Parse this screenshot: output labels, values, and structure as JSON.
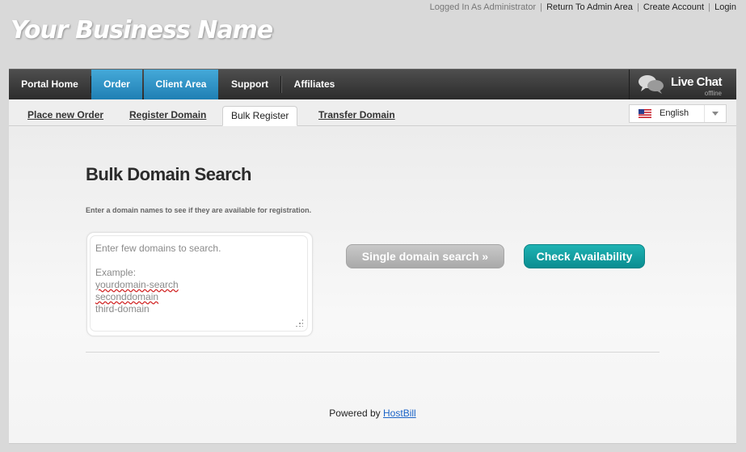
{
  "top_links": {
    "logged_in": "Logged In As Administrator",
    "separator": "|",
    "admin_area": "Return To Admin Area",
    "create_account": "Create Account",
    "login": "Login"
  },
  "brand": {
    "name": "Your Business Name"
  },
  "nav": {
    "items": [
      {
        "label": "Portal Home",
        "active": false
      },
      {
        "label": "Order",
        "active": true
      },
      {
        "label": "Client Area",
        "active": true
      },
      {
        "label": "Support",
        "active": false
      },
      {
        "label": "Affiliates",
        "active": false
      }
    ],
    "live_chat": {
      "title": "Live Chat",
      "status": "offline",
      "icon": "chat-bubbles-icon"
    }
  },
  "subtabs": [
    {
      "label": "Place new Order",
      "active": false
    },
    {
      "label": "Register Domain",
      "active": false
    },
    {
      "label": "Bulk Register",
      "active": true
    },
    {
      "label": "Transfer Domain",
      "active": false
    }
  ],
  "language": {
    "selected": "English",
    "flag_icon": "us-flag-icon"
  },
  "main": {
    "title": "Bulk Domain Search",
    "instructions": "Enter a domain names to see if they are available for registration.",
    "textarea": {
      "placeholder_line1": "Enter few domains to search.",
      "placeholder_line2": "Example:",
      "example1": "yourdomain-search",
      "example2": "seconddomain",
      "example3": "third-domain"
    },
    "single_search_button": "Single domain search »",
    "check_button": "Check Availability"
  },
  "footer": {
    "powered_by": "Powered by",
    "link": "HostBill"
  },
  "colors": {
    "nav_active": "#2b93c8",
    "check_button": "#129fa3",
    "link_blue": "#1a63c7"
  }
}
